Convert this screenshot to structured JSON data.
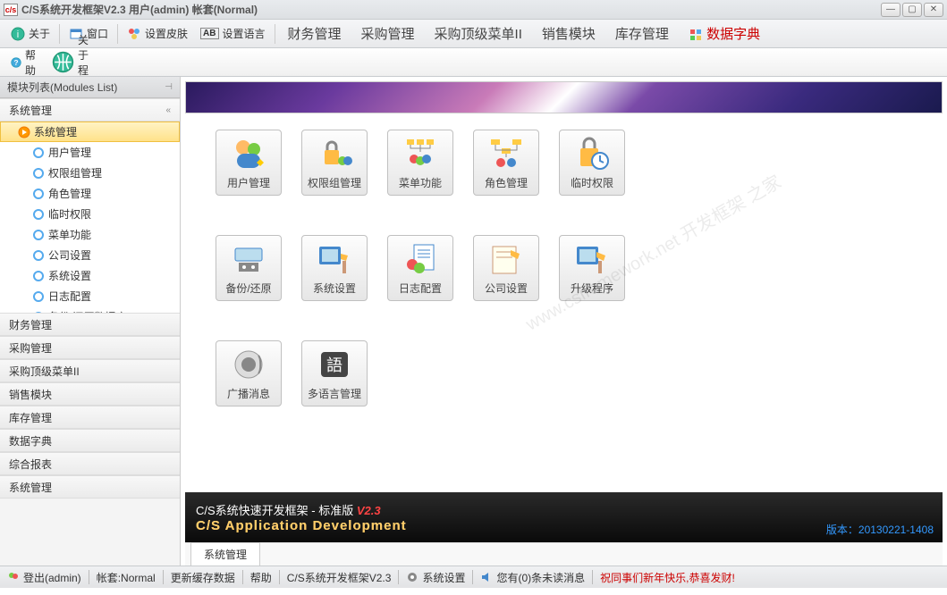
{
  "window": {
    "title": "C/S系统开发框架V2.3 用户(admin) 帐套(Normal)"
  },
  "toolbar1": {
    "about": "关于",
    "window": "窗口",
    "skin": "设置皮肤",
    "lang": "设置语言",
    "menus": [
      "财务管理",
      "采购管理",
      "采购顶级菜单II",
      "销售模块",
      "库存管理"
    ],
    "datadict": "数据字典"
  },
  "toolbar2": {
    "help": "帮助",
    "aboutprog": "关于程序"
  },
  "sidebar": {
    "title": "模块列表(Modules List)",
    "openSection": "系统管理",
    "tree": {
      "root": "系统管理",
      "subs": [
        "用户管理",
        "权限组管理",
        "角色管理",
        "临时权限",
        "菜单功能",
        "公司设置",
        "系统设置",
        "日志配置",
        "备份/还原数据库"
      ]
    },
    "sections": [
      "财务管理",
      "采购管理",
      "采购顶级菜单II",
      "销售模块",
      "库存管理",
      "数据字典",
      "综合报表",
      "系统管理"
    ]
  },
  "grid": {
    "items": [
      {
        "label": "用户管理",
        "icon": "users"
      },
      {
        "label": "权限组管理",
        "icon": "lock-users"
      },
      {
        "label": "菜单功能",
        "icon": "menu-users"
      },
      {
        "label": "角色管理",
        "icon": "role-users"
      },
      {
        "label": "临时权限",
        "icon": "lock-clock"
      },
      {
        "label": "备份/还原",
        "icon": "backup"
      },
      {
        "label": "系统设置",
        "icon": "settings"
      },
      {
        "label": "日志配置",
        "icon": "log"
      },
      {
        "label": "公司设置",
        "icon": "company"
      },
      {
        "label": "升级程序",
        "icon": "upgrade"
      },
      {
        "label": "广播消息",
        "icon": "broadcast"
      },
      {
        "label": "多语言管理",
        "icon": "language"
      }
    ],
    "watermark": "www.csframework.net 开发框架    之家"
  },
  "footer": {
    "name": "C/S系统快速开发框架 - 标准版",
    "ver": "V2.3",
    "subtitle": "C/S Application Development",
    "version": "版本：20130221-1408"
  },
  "tabs": {
    "active": "系统管理"
  },
  "statusbar": {
    "login": "登出(admin)",
    "account": "帐套:Normal",
    "refresh": "更新缓存数据",
    "help": "帮助",
    "title": "C/S系统开发框架V2.3",
    "settings": "系统设置",
    "messages": "您有(0)条未读消息",
    "greeting": "祝同事们新年快乐,恭喜发财!"
  }
}
